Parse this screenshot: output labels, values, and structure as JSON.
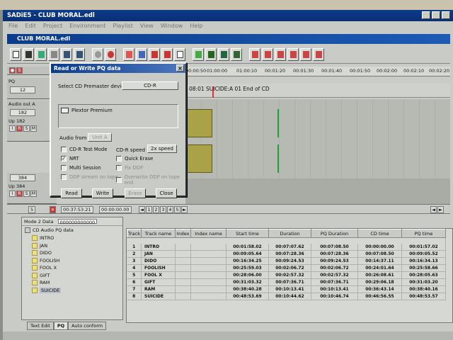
{
  "app": {
    "title": "SADiE5 - CLUB MORAL.edl",
    "menu": [
      "File",
      "Edit",
      "Project",
      "Environment",
      "Playlist",
      "View",
      "Window",
      "Help"
    ],
    "document_title": "CLUB MORAL.edl"
  },
  "timeline": {
    "ruler_ticks": [
      "00:00:50",
      "01:00:00",
      "01:00:10",
      "00:01:20",
      "00:01:30",
      "00:01:40",
      "00:01:50",
      "00:02:00",
      "00:02:10",
      "00:02:20"
    ],
    "marker_text": "08:01 SUICIDE:A 01 End of CD",
    "play_position": "00:37:53.21",
    "left_clock": "00:00:00.00",
    "pages": [
      "1",
      "2",
      "3",
      "4",
      "5"
    ],
    "tracks": [
      {
        "label": "PQ",
        "value": "12",
        "extra": ""
      },
      {
        "label": "Audio out A",
        "value": "182",
        "extra": "Up 182"
      },
      {
        "label": "",
        "value": "384",
        "extra": "Up 384"
      }
    ],
    "counter": "5"
  },
  "dialog": {
    "title": "Read or Write PQ data",
    "device_label": "Select CD Premaster device",
    "device_value": "CD-R",
    "device_list_item": "Plextor Premium",
    "audio_from_label": "Audio from",
    "audio_from_value": "Unit A",
    "speed_label": "CD-R speed",
    "speed_value": "2x speed",
    "options": [
      {
        "label": "CD-R Test Mode",
        "checked": false,
        "disabled": false
      },
      {
        "label": "NRT",
        "checked": true,
        "disabled": false
      },
      {
        "label": "Multi Session",
        "checked": false,
        "disabled": false
      },
      {
        "label": "DDP stream on tape",
        "checked": false,
        "disabled": true
      }
    ],
    "options_right": [
      {
        "label": "Quick Erase",
        "checked": false,
        "disabled": false
      },
      {
        "label": "Fix DDP",
        "checked": false,
        "disabled": true
      },
      {
        "label": "Overwrite DDP on tape end",
        "checked": false,
        "disabled": true
      }
    ],
    "buttons": {
      "read": "Read",
      "write": "Write",
      "erase": "Erase",
      "close": "Close"
    }
  },
  "panel": {
    "mode_label": "Mode 2 Data",
    "mode_value": "000000000000",
    "tree_root": "CD Audio PQ data",
    "tree_items": [
      "INTRO",
      "JAN",
      "DIDO",
      "FOOLISH",
      "FOOL X",
      "GIFT",
      "RAM",
      "SUICIDE"
    ],
    "tabs": [
      "Text Edit",
      "PQ",
      "Auto conform"
    ]
  },
  "table": {
    "columns": [
      "Track",
      "Track name",
      "Index",
      "Index name",
      "Start time",
      "Duration",
      "PQ Duration",
      "CD time",
      "PQ time"
    ],
    "rows": [
      [
        "1",
        "INTRO",
        "",
        "",
        "00:01:58.02",
        "00:07:07.62",
        "00:07:08.50",
        "00:00:00.00",
        "00:01:57.02"
      ],
      [
        "2",
        "JAN",
        "",
        "",
        "00:09:05.64",
        "00:07:28.36",
        "00:07:28.36",
        "00:07:08.50",
        "00:09:05.52"
      ],
      [
        "3",
        "DIDO",
        "",
        "",
        "00:16:34.25",
        "00:09:24.53",
        "00:09:24.53",
        "00:14:37.11",
        "00:16:34.13"
      ],
      [
        "4",
        "FOOLISH",
        "",
        "",
        "00:25:59.03",
        "00:02:06.72",
        "00:02:06.72",
        "00:24:01.64",
        "00:25:58.66"
      ],
      [
        "5",
        "FOOL X",
        "",
        "",
        "00:28:06.00",
        "00:02:57.32",
        "00:02:57.32",
        "00:26:08.61",
        "00:28:05.63"
      ],
      [
        "6",
        "GIFT",
        "",
        "",
        "00:31:03.32",
        "00:07:36.71",
        "00:07:36.71",
        "00:29:06.18",
        "00:31:03.20"
      ],
      [
        "7",
        "RAM",
        "",
        "",
        "00:38:40.28",
        "00:10:13.41",
        "00:10:13.41",
        "00:36:43.14",
        "00:38:40.16"
      ],
      [
        "8",
        "SUICIDE",
        "",
        "",
        "00:48:53.69",
        "00:10:44.62",
        "00:10:46.74",
        "00:46:56.55",
        "00:48:53.57"
      ]
    ]
  }
}
